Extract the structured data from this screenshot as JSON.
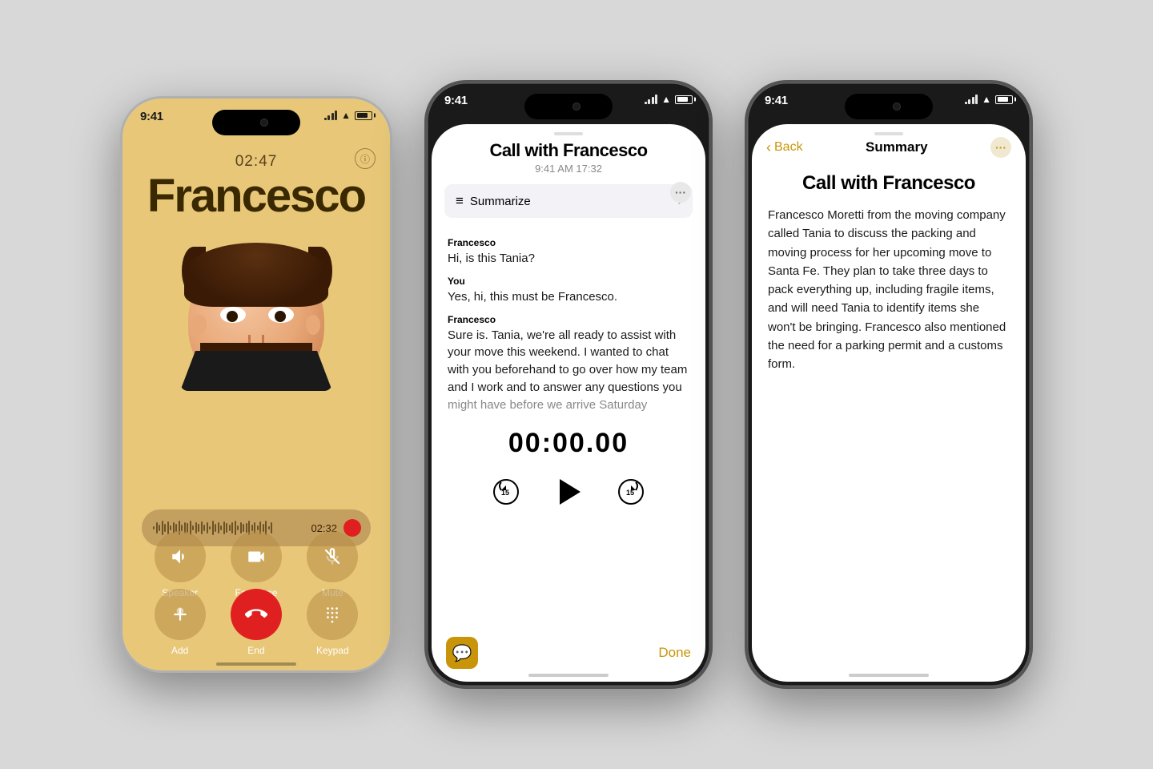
{
  "background": "#d8d8d8",
  "phone1": {
    "status_time": "9:41",
    "call_timer": "02:47",
    "caller_name": "Francesco",
    "recording_time": "02:32",
    "controls": [
      {
        "id": "speaker",
        "label": "Speaker",
        "icon": "🔊"
      },
      {
        "id": "facetime",
        "label": "FaceTime",
        "icon": "📷"
      },
      {
        "id": "mute",
        "label": "Mute",
        "icon": "🎙"
      },
      {
        "id": "add",
        "label": "Add",
        "icon": "👤+"
      },
      {
        "id": "end",
        "label": "End",
        "icon": "📞"
      },
      {
        "id": "keypad",
        "label": "Keypad",
        "icon": "⌨️"
      }
    ]
  },
  "phone2": {
    "status_time": "9:41",
    "title": "Call with Francesco",
    "subtitle": "9:41 AM  17:32",
    "summarize_label": "Summarize",
    "transcript": [
      {
        "speaker": "Francesco",
        "text": "Hi, is this Tania?"
      },
      {
        "speaker": "You",
        "text": "Yes, hi, this must be Francesco."
      },
      {
        "speaker": "Francesco",
        "text": "Sure is. Tania, we're all ready to assist with your move this weekend. I wanted to chat with you beforehand to go over how my team and I work and to answer any questions you might have before we arrive Saturday"
      }
    ],
    "playback_time": "00:00.00",
    "done_label": "Done"
  },
  "phone3": {
    "status_time": "9:41",
    "back_label": "Back",
    "nav_title": "Summary",
    "title": "Call with Francesco",
    "summary": "Francesco Moretti from the moving company called Tania to discuss the packing and moving process for her upcoming move to Santa Fe. They plan to take three days to pack everything up, including fragile items, and will need Tania to identify items she won't be bringing. Francesco also mentioned the need for a parking permit and a customs form."
  }
}
